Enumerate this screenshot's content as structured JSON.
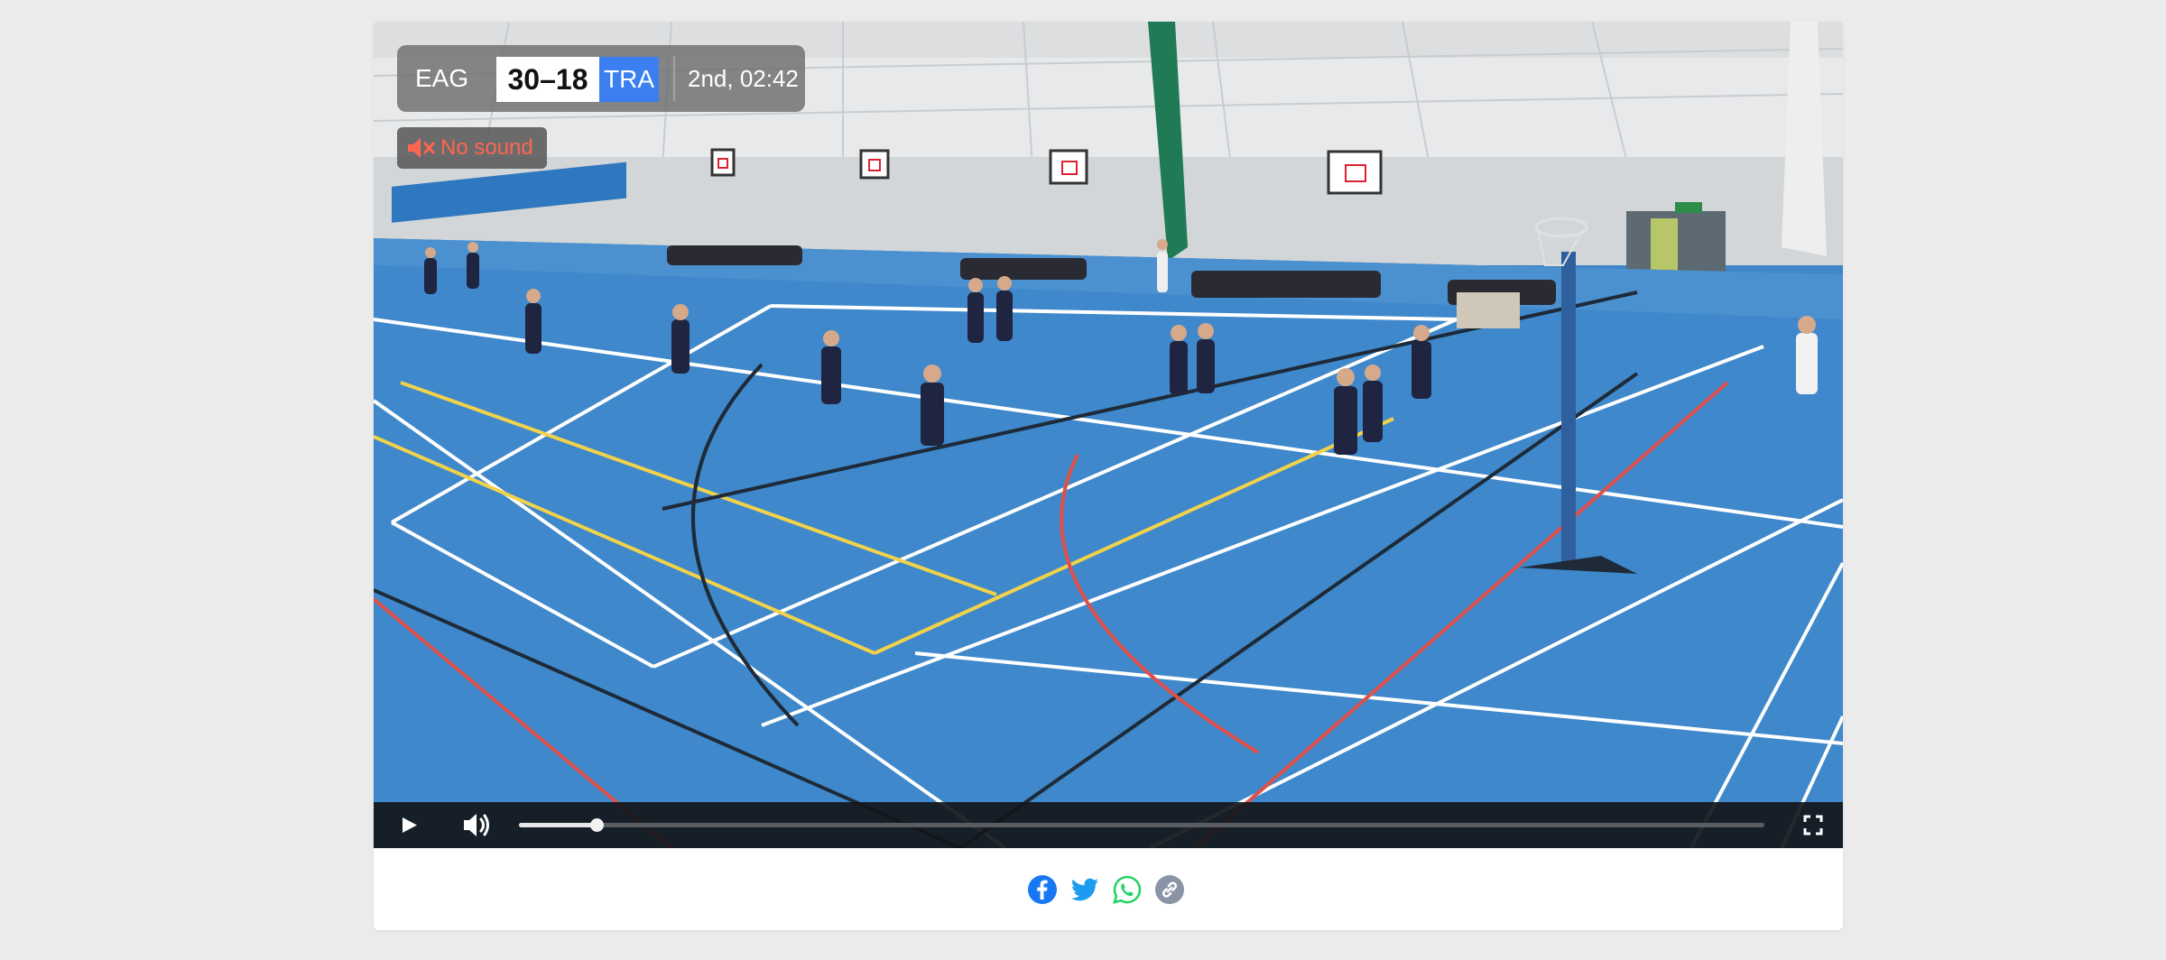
{
  "scoreboard": {
    "home_team": "EAG",
    "score": "30–18",
    "away_team": "TRA",
    "period_clock": "2nd, 02:42",
    "colors": {
      "away_bg": "#3b7ff0",
      "panel_bg": "#6e6e6e",
      "score_bg": "#ffffff"
    }
  },
  "audio_notice": {
    "label": "No sound",
    "icon": "speaker-muted-icon",
    "color": "#ff6650"
  },
  "player": {
    "play_icon": "play-icon",
    "volume_icon": "volume-icon",
    "fullscreen_icon": "fullscreen-icon",
    "progress_fraction": 0.062
  },
  "share": {
    "items": [
      {
        "name": "facebook",
        "icon": "facebook-icon",
        "color": "#1877f2"
      },
      {
        "name": "twitter",
        "icon": "twitter-icon",
        "color": "#1d9bf0"
      },
      {
        "name": "whatsapp",
        "icon": "whatsapp-icon",
        "color": "#25d366"
      },
      {
        "name": "copy-link",
        "icon": "link-icon",
        "color": "#8a94a6"
      }
    ]
  }
}
